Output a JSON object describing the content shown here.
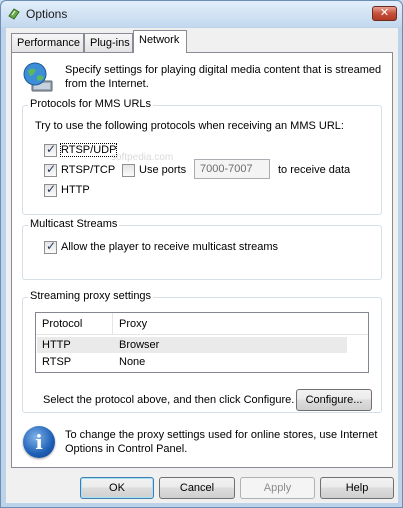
{
  "window": {
    "title": "Options",
    "close_glyph": "✕"
  },
  "tabs": [
    {
      "label": "Performance"
    },
    {
      "label": "Plug-ins"
    },
    {
      "label": "Network"
    }
  ],
  "intro": "Specify settings for playing digital media content that is streamed from the Internet.",
  "intro_line1": "Specify settings for playing digital media content that is streamed",
  "intro_line2": "from the Internet.",
  "protocols": {
    "title": "Protocols for MMS URLs",
    "description": "Try to use the following protocols when receiving an MMS URL:",
    "rtsp_udp": {
      "label": "RTSP/UDP",
      "checked": true
    },
    "rtsp_tcp": {
      "label": "RTSP/TCP",
      "checked": true
    },
    "use_ports": {
      "label": "Use ports",
      "checked": false
    },
    "ports_value": "7000-7007",
    "receive_label": "to receive data",
    "http": {
      "label": "HTTP",
      "checked": true
    }
  },
  "multicast": {
    "title": "Multicast Streams",
    "allow": {
      "label": "Allow the player to receive multicast streams",
      "checked": true
    }
  },
  "proxy": {
    "title": "Streaming proxy settings",
    "columns": [
      "Protocol",
      "Proxy"
    ],
    "rows": [
      {
        "protocol": "HTTP",
        "proxy": "Browser"
      },
      {
        "protocol": "RTSP",
        "proxy": "None"
      }
    ],
    "instruction": "Select the protocol above, and then click Configure.",
    "configure_label": "Configure..."
  },
  "info": {
    "line1": "To change the proxy settings used for online stores, use Internet",
    "line2": "Options in Control Panel."
  },
  "buttons": {
    "ok": "OK",
    "cancel": "Cancel",
    "apply": "Apply",
    "help": "Help"
  },
  "watermark": "softpedia.com",
  "colors": {
    "accent": "#3c7fb1",
    "titlebar": "#c3d8ee",
    "close": "#c6503a"
  }
}
